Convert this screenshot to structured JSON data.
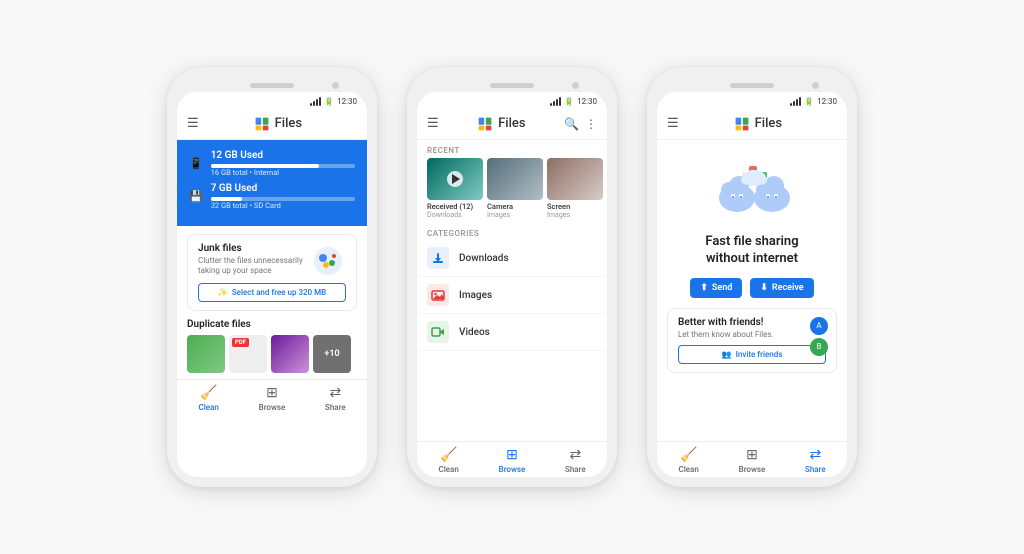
{
  "bg_color": "#f8f8f8",
  "phones": [
    {
      "id": "phone1",
      "status_time": "12:30",
      "app_title": "Files",
      "has_hamburger": true,
      "screen": "clean",
      "storage": [
        {
          "label": "12 GB Used",
          "sub": "16 GB total • Internal",
          "fill_pct": 75
        },
        {
          "label": "7 GB Used",
          "sub": "32 GB total • SD Card",
          "fill_pct": 22
        }
      ],
      "junk": {
        "title": "Junk files",
        "desc": "Clutter the files unnecessarily taking up your space",
        "cta": "Select and free up 320 MB"
      },
      "duplicate": {
        "title": "Duplicate files",
        "thumbs": [
          "green",
          "pdf",
          "purple",
          "+10"
        ]
      }
    },
    {
      "id": "phone2",
      "status_time": "12:30",
      "app_title": "Files",
      "has_hamburger": true,
      "has_search": true,
      "has_more": true,
      "screen": "browse",
      "recent_label": "RECENT",
      "recent_items": [
        {
          "label": "Received (12)",
          "sub": "Downloads",
          "type": "video"
        },
        {
          "label": "Camera",
          "sub": "Images",
          "type": "storm"
        },
        {
          "label": "Screen",
          "sub": "Images",
          "type": "animal"
        }
      ],
      "categories_label": "CATEGORIES",
      "categories": [
        {
          "name": "Downloads",
          "icon": "⬇",
          "color": "#1a73e8"
        },
        {
          "name": "Images",
          "icon": "🖼",
          "color": "#e53935"
        },
        {
          "name": "Videos",
          "icon": "🎬",
          "color": "#43a047"
        }
      ]
    },
    {
      "id": "phone3",
      "status_time": "12:30",
      "app_title": "Files",
      "has_hamburger": true,
      "screen": "share",
      "share_title": "Fast file sharing\nwithout internet",
      "send_label": "Send",
      "receive_label": "Receive",
      "friends_title": "Better with friends!",
      "friends_desc": "Let them know about Files.",
      "invite_label": "Invite friends"
    }
  ],
  "nav": {
    "clean": "Clean",
    "browse": "Browse",
    "share": "Share"
  }
}
